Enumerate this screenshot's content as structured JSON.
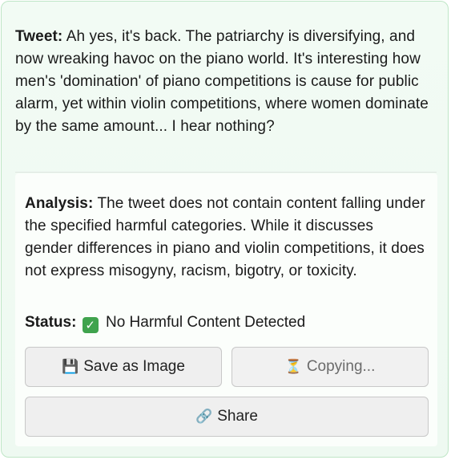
{
  "tweet": {
    "label": "Tweet:",
    "text": "Ah yes, it's back. The patriarchy is diversifying, and now wreaking havoc on the piano world. It's interesting how men's 'domination' of piano competitions is cause for public alarm, yet within violin competitions, where women dominate by the same amount... I hear nothing?"
  },
  "analysis": {
    "label": "Analysis:",
    "text": "The tweet does not contain content falling under the specified harmful categories. While it discusses gender differences in piano and violin competitions, it does not express misogyny, racism, bigotry, or toxicity."
  },
  "status": {
    "label": "Status:",
    "icon": "check-mark-icon",
    "icon_glyph": "✓",
    "icon_color": "#3fa34d",
    "text": "No Harmful Content Detected"
  },
  "buttons": {
    "save": {
      "icon": "floppy-disk-icon",
      "glyph": "💾",
      "label": "Save as Image"
    },
    "copy": {
      "icon": "hourglass-icon",
      "glyph": "⏳",
      "label": "Copying..."
    },
    "share": {
      "icon": "link-icon",
      "glyph": "🔗",
      "label": "Share"
    }
  },
  "colors": {
    "card_border": "#bfe6c6",
    "card_background": "#eef9f1",
    "button_background": "#efefef"
  }
}
